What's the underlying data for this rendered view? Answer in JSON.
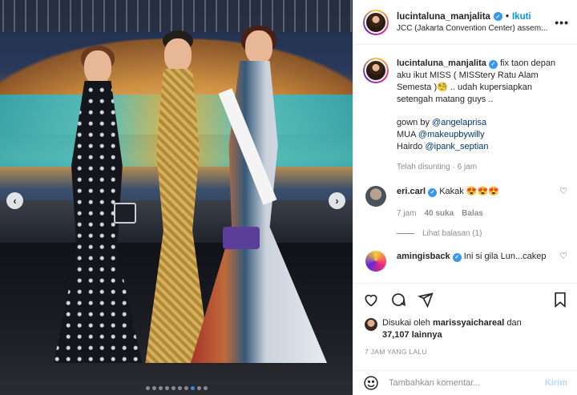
{
  "post": {
    "username": "lucintaluna_manjalita",
    "follow_label": "Ikuti",
    "location": "JCC (Jakarta Convention Center) assem...",
    "more_label": "•••",
    "caption": {
      "line1": "fix taon depan",
      "line2": "aku ikut MISS ( MISStery Ratu Alam",
      "line3": "Semesta )🧐 .. udah kupersiapkan",
      "line4": "setengah matang guys ..",
      "gown_prefix": "gown by",
      "gown_mention": "@angelaprisa",
      "mua_prefix": "MUA",
      "mua_mention": "@makeupbywilly",
      "hair_prefix": "Hairdo",
      "hair_mention": "@ipank_septian"
    },
    "edited_label": "Telah disunting · 6 jam"
  },
  "comments": [
    {
      "username": "eri.carl",
      "text": "Kakak 😍😍😍",
      "time": "7 jam",
      "likes": "40 suka",
      "reply": "Balas",
      "replies_label": "Lihat balasan (1)"
    },
    {
      "username": "amingisback",
      "text": "Ini si gila Lun...cakep"
    }
  ],
  "likes": {
    "prefix": "Disukai oleh",
    "user": "marissyaichareal",
    "conj": "dan",
    "count": "37,107",
    "suffix": "lainnya"
  },
  "date_label": "7 JAM YANG LALU",
  "add_comment": {
    "placeholder": "Tambahkan komentar...",
    "post_label": "Kirim"
  },
  "carousel": {
    "prev": "‹",
    "next": "›",
    "total_dots": 10,
    "active_dot": 7
  },
  "colors": {
    "link": "#0095f6",
    "mention": "#00376b",
    "muted": "#8e8e8e",
    "verified": "#3897f0"
  },
  "icons": [
    "heart-icon",
    "comment-icon",
    "share-icon",
    "bookmark-icon",
    "emoji-icon",
    "verified-icon",
    "more-icon"
  ]
}
